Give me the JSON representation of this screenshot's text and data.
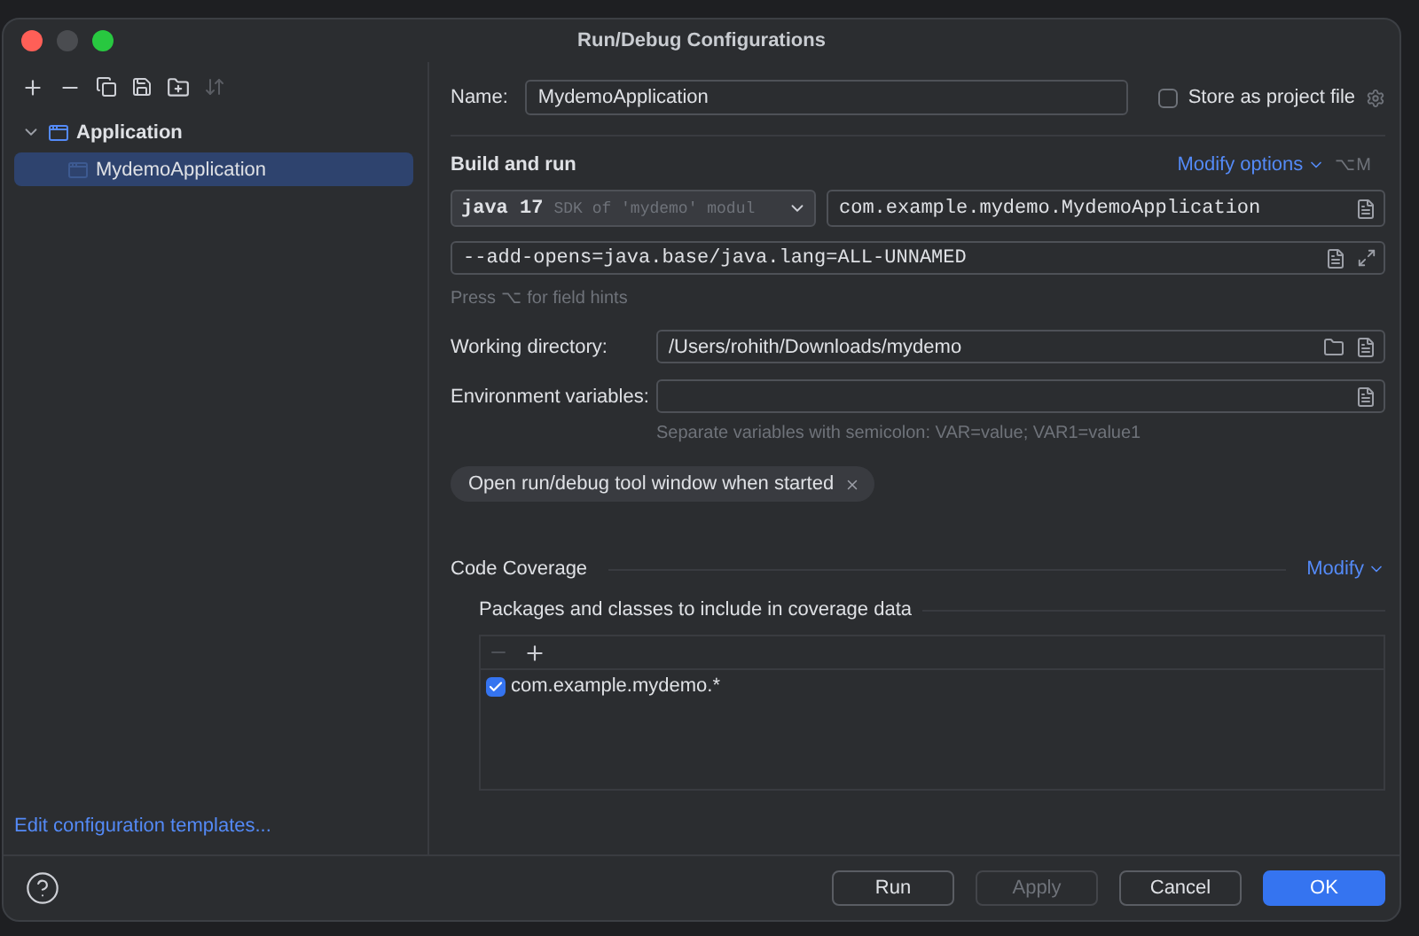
{
  "window": {
    "title": "Run/Debug Configurations"
  },
  "tree": [
    {
      "label": "Application",
      "expanded": true,
      "children": [
        {
          "label": "MydemoApplication",
          "selected": true
        }
      ]
    }
  ],
  "templates_link": "Edit configuration templates...",
  "name": {
    "label": "Name:",
    "value": "MydemoApplication"
  },
  "store_as_project_file": {
    "label": "Store as project file",
    "checked": false
  },
  "build_and_run": {
    "title": "Build and run",
    "modify_options": "Modify options",
    "shortcut": "⌥M",
    "jdk": {
      "name": "java 17",
      "detail": "SDK of 'mydemo' modul"
    },
    "main_class": "com.example.mydemo.MydemoApplication",
    "vm_options": "--add-opens=java.base/java.lang=ALL-UNNAMED",
    "hint": "Press ⌥ for field hints"
  },
  "working_directory": {
    "label": "Working directory:",
    "value": "/Users/rohith/Downloads/mydemo"
  },
  "environment_variables": {
    "label": "Environment variables:",
    "hint": "Separate variables with semicolon: VAR=value; VAR1=value1"
  },
  "chips": [
    {
      "label": "Open run/debug tool window when started"
    }
  ],
  "code_coverage": {
    "title": "Code Coverage",
    "modify": "Modify",
    "packages_title": "Packages and classes to include in coverage data",
    "remove_disabled": true,
    "items": [
      {
        "label": "com.example.mydemo.*",
        "checked": true
      }
    ]
  },
  "buttons": [
    {
      "label": "Run",
      "kind": "normal",
      "disabled": false
    },
    {
      "label": "Apply",
      "kind": "normal",
      "disabled": true
    },
    {
      "label": "Cancel",
      "kind": "normal",
      "disabled": false
    },
    {
      "label": "OK",
      "kind": "default",
      "disabled": false
    }
  ]
}
